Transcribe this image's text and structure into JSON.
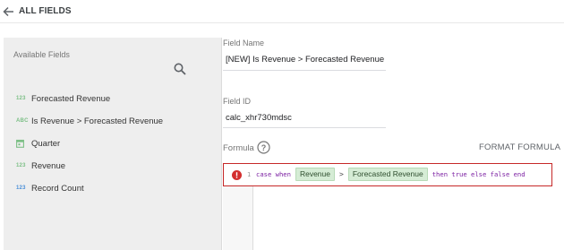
{
  "header": {
    "title": "ALL FIELDS",
    "back_icon": "arrow-left-icon"
  },
  "sidebar": {
    "title": "Available Fields",
    "search_icon": "search-icon",
    "fields": [
      {
        "type_badge": "123",
        "label": "Forecasted Revenue"
      },
      {
        "type_badge": "ABC",
        "label": "Is Revenue > Forecasted Revenue"
      },
      {
        "type_badge": "",
        "type_icon": "calendar-icon",
        "label": "Quarter"
      },
      {
        "type_badge": "123",
        "label": "Revenue"
      },
      {
        "type_badge": "123",
        "label": "Record Count"
      }
    ]
  },
  "form": {
    "field_name_label": "Field Name",
    "field_name_value": "[NEW] Is Revenue > Forecasted Revenue",
    "field_id_label": "Field ID",
    "field_id_value": "calc_xhr730mdsc",
    "formula_label": "Formula",
    "help_icon": "help-circle-icon",
    "format_button": "FORMAT FORMULA"
  },
  "editor": {
    "line_number": "1",
    "error_icon": "error-icon",
    "tokens": {
      "kw1": "case when",
      "chip1": "Revenue",
      "op": ">",
      "chip2": "Forecasted Revenue",
      "kw2": "then true else false end"
    }
  },
  "colors": {
    "error_border": "#c62828",
    "chip_bg": "#d5ecd5",
    "keyword": "#7b1fa2"
  }
}
